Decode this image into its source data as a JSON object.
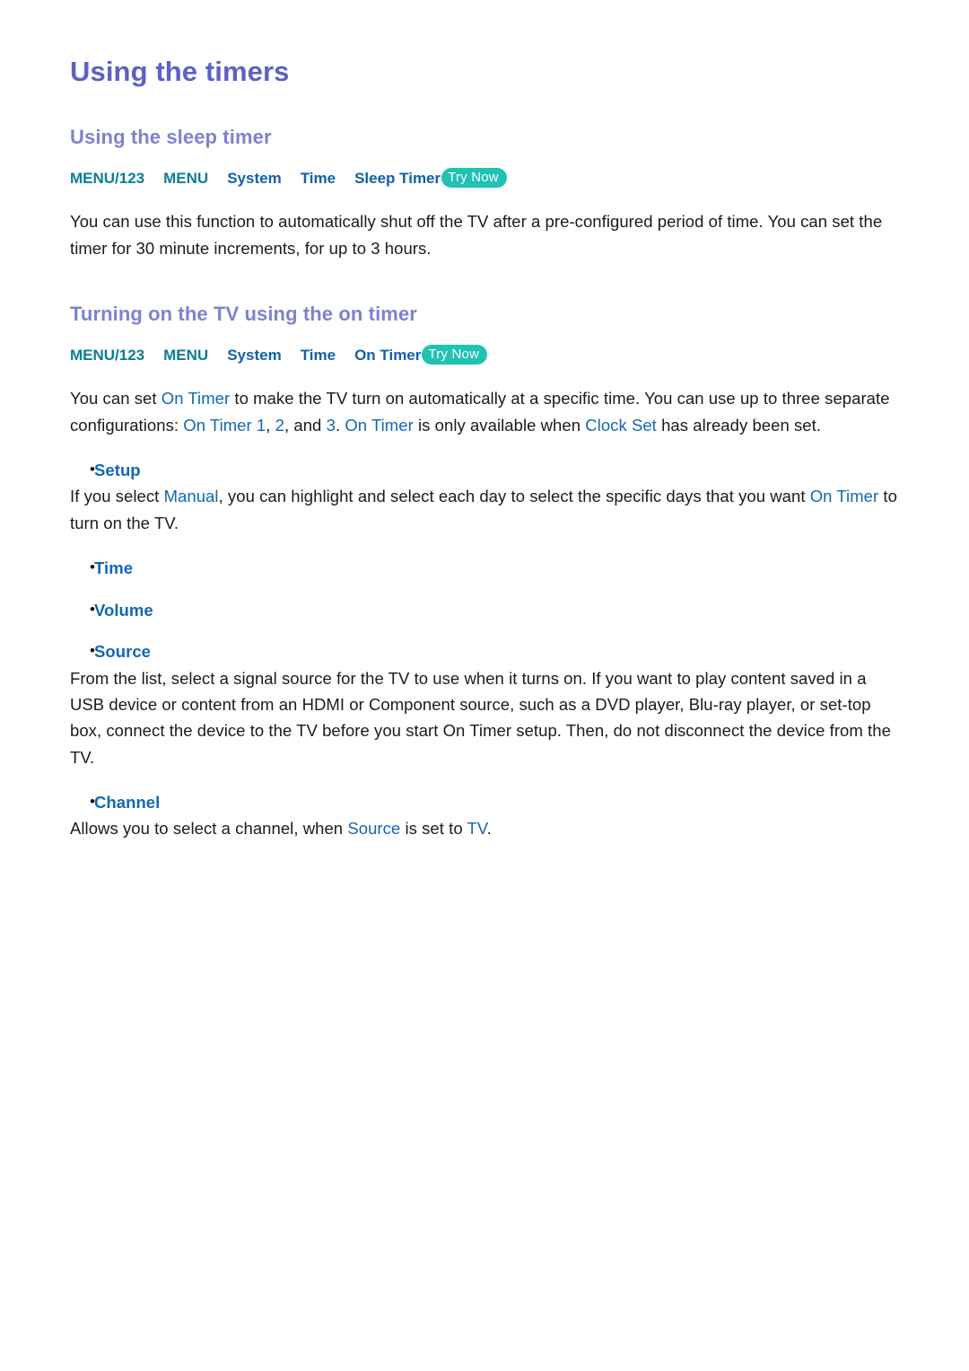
{
  "page": {
    "title": "Using the timers"
  },
  "colors": {
    "page_title": "#5d61c4",
    "section_title": "#7e82cf",
    "crumb_blue": "#1260a8",
    "crumb_teal": "#0b7d96",
    "try_now_badge": "#20c2b2",
    "inline_term": "#1268b3",
    "body_text": "#1b1b1b"
  },
  "sections": [
    {
      "heading": "Using the sleep timer",
      "breadcrumb": {
        "crumbs": [
          "MENU/123",
          "MENU",
          "System",
          "Time",
          "Sleep Timer"
        ],
        "badge": "Try Now"
      },
      "paragraph": {
        "part1": "You can use this function to automatically shut off the TV after a pre-configured period of time. You can set the timer for 30 minute increments, for up to 3 hours."
      }
    },
    {
      "heading": "Turning on the TV using the on timer",
      "breadcrumb": {
        "crumbs": [
          "MENU/123",
          "MENU",
          "System",
          "Time",
          "On Timer"
        ],
        "badge": "Try Now"
      },
      "intro": {
        "p1a": "You can set ",
        "t1": "On Timer",
        "p1b": " to make the TV turn on automatically at a specific time. You can use up to three separate configurations: ",
        "t2": "On Timer 1",
        "p1c": ", ",
        "t3": "2",
        "p1d": ", and ",
        "t4": "3",
        "p1e": ". ",
        "t5": "On Timer",
        "p1f": " is only available when ",
        "t6": "Clock Set",
        "p1g": " has already been set."
      },
      "bullets": [
        {
          "label": "Setup",
          "desc": {
            "a": "If you select ",
            "t1": "Manual",
            "b": ", you can highlight and select each day to select the specific days that you want ",
            "t2": "On Timer",
            "c": " to turn on the TV."
          }
        },
        {
          "label": "Time"
        },
        {
          "label": "Volume"
        },
        {
          "label": "Source",
          "desc_plain": "From the list, select a signal source for the TV to use when it turns on. If you want to play content saved in a USB device or content from an HDMI or Component source, such as a DVD player, Blu-ray player, or set-top box, connect the device to the TV before you start On Timer setup. Then, do not disconnect the device from the TV."
        },
        {
          "label": "Channel",
          "desc": {
            "a": "Allows you to select a channel, when ",
            "t1": "Source",
            "b": " is set to ",
            "t2": "TV",
            "c": "."
          }
        }
      ]
    }
  ],
  "bullet_glyph": "•"
}
